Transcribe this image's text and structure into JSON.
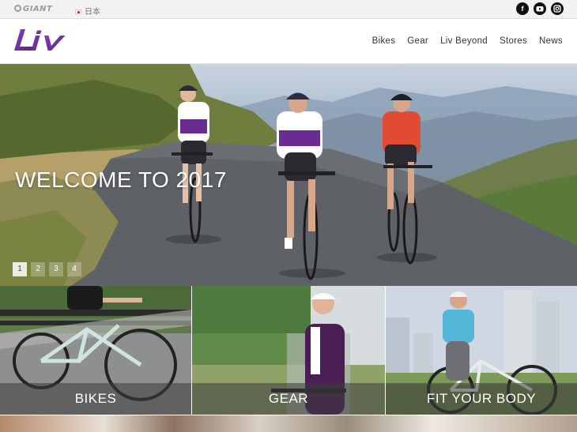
{
  "topbar": {
    "brand": "GIANT",
    "language": "日本",
    "social": [
      {
        "name": "facebook",
        "glyph": "f"
      },
      {
        "name": "youtube",
        "glyph": "▶"
      },
      {
        "name": "instagram",
        "glyph": "◎"
      }
    ]
  },
  "header": {
    "logo": "Liv",
    "logo_color": "#6a2c91",
    "nav": [
      "Bikes",
      "Gear",
      "Liv Beyond",
      "Stores",
      "News"
    ]
  },
  "hero": {
    "title": "WELCOME TO 2017",
    "pages": [
      "1",
      "2",
      "3",
      "4"
    ],
    "active_page": "1"
  },
  "tiles": [
    {
      "label": "BIKES"
    },
    {
      "label": "GEAR"
    },
    {
      "label": "FIT YOUR BODY"
    }
  ]
}
